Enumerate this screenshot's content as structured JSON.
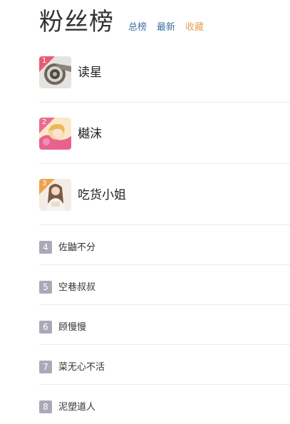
{
  "header": {
    "title": "粉丝榜",
    "tabs": [
      {
        "label": "总榜",
        "active": false
      },
      {
        "label": "最新",
        "active": false
      },
      {
        "label": "收藏",
        "active": true
      }
    ]
  },
  "colors": {
    "tab_link": "#3f6fa3",
    "tab_active": "#e5a05b",
    "rank1": "#e75b74",
    "rank2": "#ea6b93",
    "rank3": "#f0a24d",
    "rank_other": "#a9a9b8"
  },
  "top_fans": [
    {
      "rank": "1",
      "name": "读星",
      "avatar": "scroll-avatar"
    },
    {
      "rank": "2",
      "name": "樾沫",
      "avatar": "anime-girl-avatar"
    },
    {
      "rank": "3",
      "name": "吃货小姐",
      "avatar": "girl-photo-avatar"
    }
  ],
  "other_fans": [
    {
      "rank": "4",
      "name": "佐鼬不分"
    },
    {
      "rank": "5",
      "name": "空巷叔叔"
    },
    {
      "rank": "6",
      "name": "顾慢慢"
    },
    {
      "rank": "7",
      "name": "菜无心不活"
    },
    {
      "rank": "8",
      "name": "泥塑道人"
    }
  ]
}
